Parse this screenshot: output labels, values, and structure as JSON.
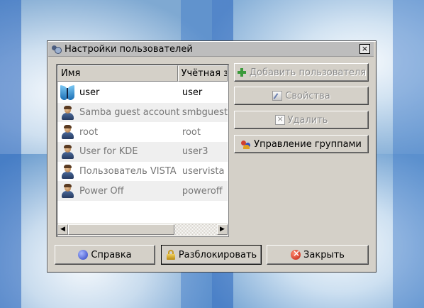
{
  "window": {
    "title": "Настройки пользователей",
    "close_glyph": "×"
  },
  "list": {
    "columns": [
      "Имя",
      "Учётная за"
    ],
    "rows": [
      {
        "name": "user",
        "account": "user",
        "icon": "butterfly-icon",
        "active": true
      },
      {
        "name": "Samba guest account",
        "account": "smbguest",
        "icon": "person-icon",
        "active": false
      },
      {
        "name": "root",
        "account": "root",
        "icon": "person-icon",
        "active": false
      },
      {
        "name": "User for KDE",
        "account": "user3",
        "icon": "person-icon",
        "active": false
      },
      {
        "name": "Пользователь VISTA",
        "account": "uservista",
        "icon": "person-icon",
        "active": false
      },
      {
        "name": "Power Off",
        "account": "poweroff",
        "icon": "person-icon",
        "active": false
      }
    ]
  },
  "actions": {
    "add_user": "Добавить пользователя",
    "properties": "Свойства",
    "delete": "Удалить",
    "manage_groups": "Управление группами"
  },
  "footer": {
    "help": "Справка",
    "unlock": "Разблокировать",
    "close": "Закрыть"
  }
}
